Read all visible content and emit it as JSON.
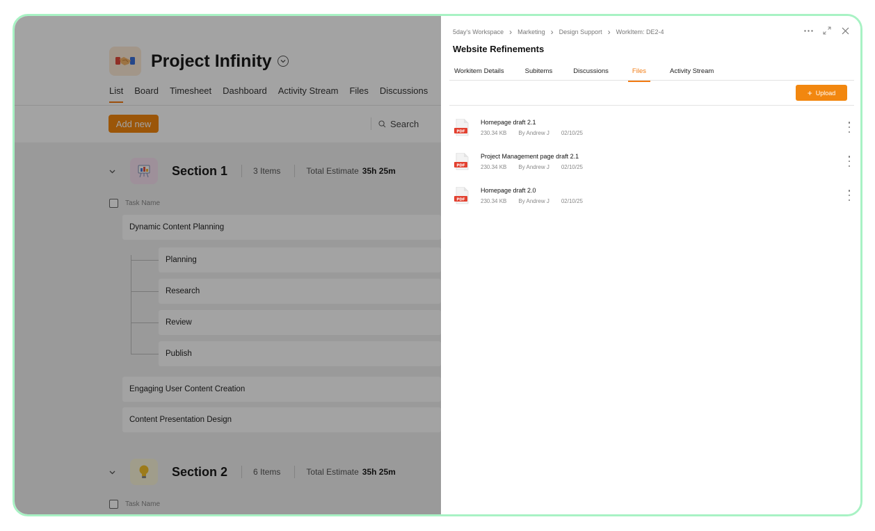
{
  "project": {
    "title": "Project Infinity",
    "tabs": [
      "List",
      "Board",
      "Timesheet",
      "Dashboard",
      "Activity Stream",
      "Files",
      "Discussions"
    ],
    "add_new_label": "Add new",
    "search_label": "Search"
  },
  "sections": [
    {
      "title": "Section 1",
      "items_count": "3 Items",
      "estimate_label": "Total Estimate",
      "estimate_value": "35h 25m",
      "task_name_header": "Task Name",
      "tasks": [
        {
          "name": "Dynamic Content Planning",
          "subtasks": [
            "Planning",
            "Research",
            "Review",
            "Publish"
          ]
        },
        {
          "name": "Engaging User Content Creation"
        },
        {
          "name": "Content Presentation Design"
        }
      ]
    },
    {
      "title": "Section 2",
      "items_count": "6 Items",
      "estimate_label": "Total Estimate",
      "estimate_value": "35h 25m",
      "task_name_header": "Task Name"
    }
  ],
  "panel": {
    "breadcrumbs": [
      "5day's Workspace",
      "Marketing",
      "Design Support",
      "WorkItem: DE2-4"
    ],
    "title": "Website Refinements",
    "tabs": [
      "Workitem Details",
      "Subitems",
      "Discussions",
      "Files",
      "Activity Stream"
    ],
    "active_tab": "Files",
    "upload_label": "Upload",
    "pdf_badge": "PDF",
    "files": [
      {
        "name": "Homepage draft 2.1",
        "size": "230.34 KB",
        "author": "By Andrew J",
        "date": "02/10/25"
      },
      {
        "name": "Project Management page draft 2.1",
        "size": "230.34 KB",
        "author": "By Andrew J",
        "date": "02/10/25"
      },
      {
        "name": "Homepage draft 2.0",
        "size": "230.34 KB",
        "author": "By Andrew J",
        "date": "02/10/25"
      }
    ]
  },
  "colors": {
    "accent": "#f2870f",
    "frame_border": "#a8f2c4",
    "pdf_red": "#e2402f"
  },
  "icons": [
    "handshake-icon",
    "chevron-down-circle-icon",
    "search-icon",
    "presentation-board-icon",
    "lightbulb-icon",
    "more-horizontal-icon",
    "expand-icon",
    "close-icon",
    "pdf-file-icon",
    "kebab-menu-icon"
  ]
}
